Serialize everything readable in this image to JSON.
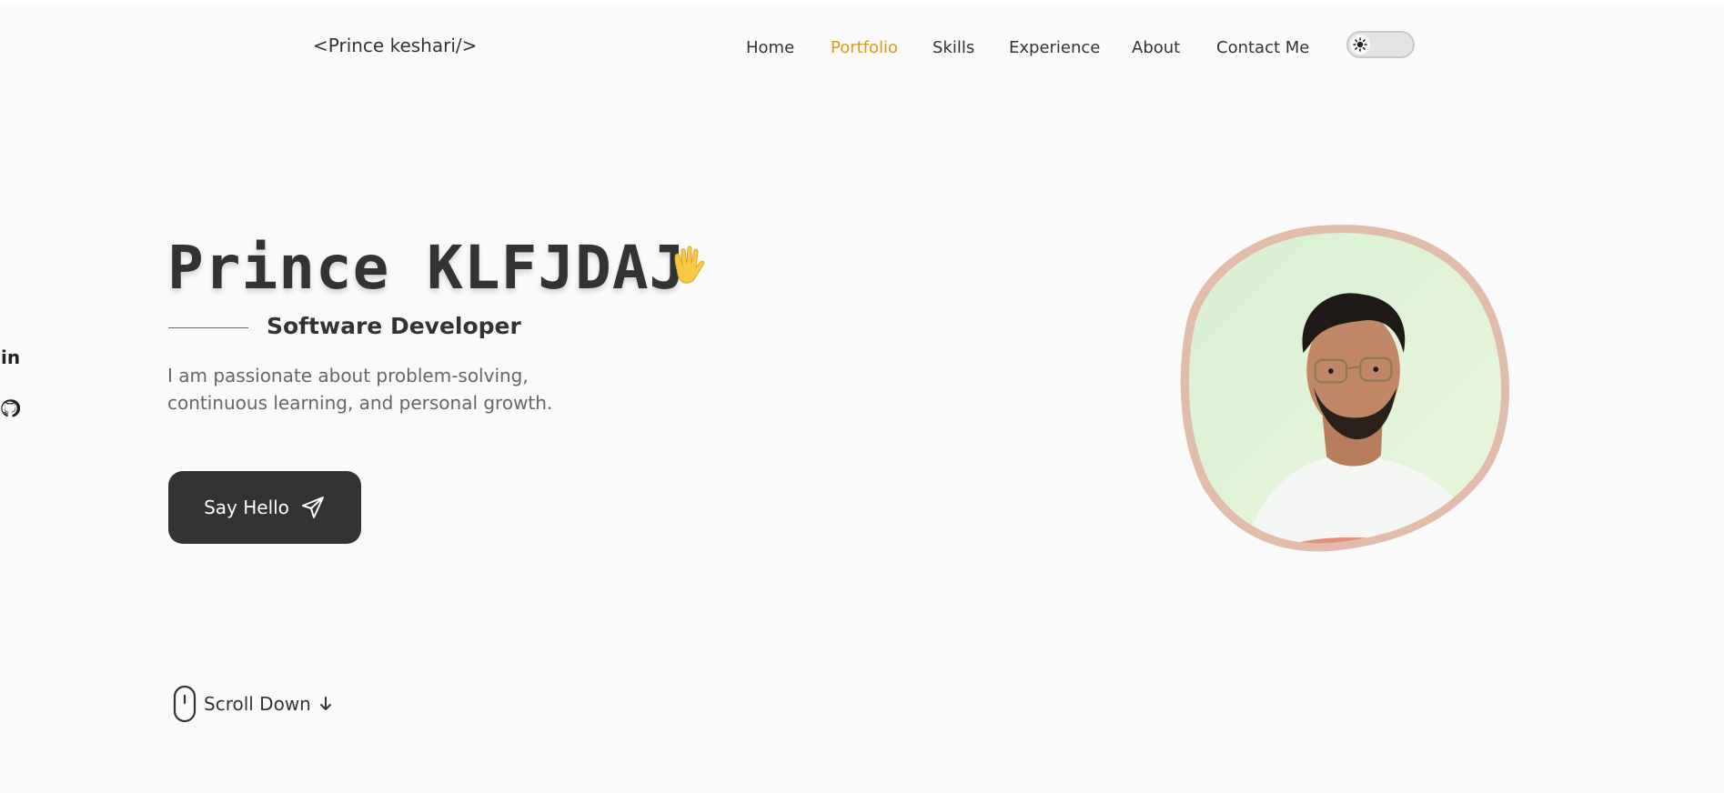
{
  "header": {
    "logo": "<Prince keshari/>",
    "nav": [
      {
        "label": "Home",
        "active": false
      },
      {
        "label": "Portfolio",
        "active": true
      },
      {
        "label": "Skills",
        "active": false
      },
      {
        "label": "Experience",
        "active": false
      },
      {
        "label": "About",
        "active": false
      },
      {
        "label": "Contact Me",
        "active": false
      }
    ],
    "theme_toggle_icon": "sun-icon"
  },
  "social": [
    {
      "icon": "linkedin-icon",
      "text": "in"
    },
    {
      "icon": "github-icon"
    }
  ],
  "hero": {
    "name": "Prince KLFJDAJ",
    "wave_icon": "waving-hand-icon",
    "subtitle": "Software Developer",
    "description": "I am passionate about problem-solving, continuous learning, and personal growth.",
    "cta_label": "Say Hello",
    "cta_icon": "send-icon",
    "scroll_label": "Scroll Down",
    "scroll_icons": [
      "mouse-icon",
      "arrow-down-icon"
    ]
  },
  "colors": {
    "accent": "#dc9b0c",
    "text": "#333333",
    "muted": "#666666",
    "background": "#fafafa",
    "button": "#333333",
    "portrait_border": "#e2bcaa"
  }
}
